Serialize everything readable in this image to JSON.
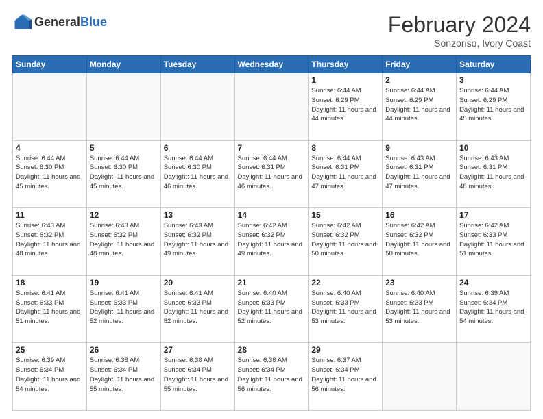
{
  "logo": {
    "general": "General",
    "blue": "Blue"
  },
  "header": {
    "month": "February 2024",
    "subtitle": "Sonzoriso, Ivory Coast"
  },
  "weekdays": [
    "Sunday",
    "Monday",
    "Tuesday",
    "Wednesday",
    "Thursday",
    "Friday",
    "Saturday"
  ],
  "weeks": [
    [
      {
        "day": "",
        "info": ""
      },
      {
        "day": "",
        "info": ""
      },
      {
        "day": "",
        "info": ""
      },
      {
        "day": "",
        "info": ""
      },
      {
        "day": "1",
        "info": "Sunrise: 6:44 AM\nSunset: 6:29 PM\nDaylight: 11 hours and 44 minutes."
      },
      {
        "day": "2",
        "info": "Sunrise: 6:44 AM\nSunset: 6:29 PM\nDaylight: 11 hours and 44 minutes."
      },
      {
        "day": "3",
        "info": "Sunrise: 6:44 AM\nSunset: 6:29 PM\nDaylight: 11 hours and 45 minutes."
      }
    ],
    [
      {
        "day": "4",
        "info": "Sunrise: 6:44 AM\nSunset: 6:30 PM\nDaylight: 11 hours and 45 minutes."
      },
      {
        "day": "5",
        "info": "Sunrise: 6:44 AM\nSunset: 6:30 PM\nDaylight: 11 hours and 45 minutes."
      },
      {
        "day": "6",
        "info": "Sunrise: 6:44 AM\nSunset: 6:30 PM\nDaylight: 11 hours and 46 minutes."
      },
      {
        "day": "7",
        "info": "Sunrise: 6:44 AM\nSunset: 6:31 PM\nDaylight: 11 hours and 46 minutes."
      },
      {
        "day": "8",
        "info": "Sunrise: 6:44 AM\nSunset: 6:31 PM\nDaylight: 11 hours and 47 minutes."
      },
      {
        "day": "9",
        "info": "Sunrise: 6:43 AM\nSunset: 6:31 PM\nDaylight: 11 hours and 47 minutes."
      },
      {
        "day": "10",
        "info": "Sunrise: 6:43 AM\nSunset: 6:31 PM\nDaylight: 11 hours and 48 minutes."
      }
    ],
    [
      {
        "day": "11",
        "info": "Sunrise: 6:43 AM\nSunset: 6:32 PM\nDaylight: 11 hours and 48 minutes."
      },
      {
        "day": "12",
        "info": "Sunrise: 6:43 AM\nSunset: 6:32 PM\nDaylight: 11 hours and 48 minutes."
      },
      {
        "day": "13",
        "info": "Sunrise: 6:43 AM\nSunset: 6:32 PM\nDaylight: 11 hours and 49 minutes."
      },
      {
        "day": "14",
        "info": "Sunrise: 6:42 AM\nSunset: 6:32 PM\nDaylight: 11 hours and 49 minutes."
      },
      {
        "day": "15",
        "info": "Sunrise: 6:42 AM\nSunset: 6:32 PM\nDaylight: 11 hours and 50 minutes."
      },
      {
        "day": "16",
        "info": "Sunrise: 6:42 AM\nSunset: 6:32 PM\nDaylight: 11 hours and 50 minutes."
      },
      {
        "day": "17",
        "info": "Sunrise: 6:42 AM\nSunset: 6:33 PM\nDaylight: 11 hours and 51 minutes."
      }
    ],
    [
      {
        "day": "18",
        "info": "Sunrise: 6:41 AM\nSunset: 6:33 PM\nDaylight: 11 hours and 51 minutes."
      },
      {
        "day": "19",
        "info": "Sunrise: 6:41 AM\nSunset: 6:33 PM\nDaylight: 11 hours and 52 minutes."
      },
      {
        "day": "20",
        "info": "Sunrise: 6:41 AM\nSunset: 6:33 PM\nDaylight: 11 hours and 52 minutes."
      },
      {
        "day": "21",
        "info": "Sunrise: 6:40 AM\nSunset: 6:33 PM\nDaylight: 11 hours and 52 minutes."
      },
      {
        "day": "22",
        "info": "Sunrise: 6:40 AM\nSunset: 6:33 PM\nDaylight: 11 hours and 53 minutes."
      },
      {
        "day": "23",
        "info": "Sunrise: 6:40 AM\nSunset: 6:33 PM\nDaylight: 11 hours and 53 minutes."
      },
      {
        "day": "24",
        "info": "Sunrise: 6:39 AM\nSunset: 6:34 PM\nDaylight: 11 hours and 54 minutes."
      }
    ],
    [
      {
        "day": "25",
        "info": "Sunrise: 6:39 AM\nSunset: 6:34 PM\nDaylight: 11 hours and 54 minutes."
      },
      {
        "day": "26",
        "info": "Sunrise: 6:38 AM\nSunset: 6:34 PM\nDaylight: 11 hours and 55 minutes."
      },
      {
        "day": "27",
        "info": "Sunrise: 6:38 AM\nSunset: 6:34 PM\nDaylight: 11 hours and 55 minutes."
      },
      {
        "day": "28",
        "info": "Sunrise: 6:38 AM\nSunset: 6:34 PM\nDaylight: 11 hours and 56 minutes."
      },
      {
        "day": "29",
        "info": "Sunrise: 6:37 AM\nSunset: 6:34 PM\nDaylight: 11 hours and 56 minutes."
      },
      {
        "day": "",
        "info": ""
      },
      {
        "day": "",
        "info": ""
      }
    ]
  ]
}
